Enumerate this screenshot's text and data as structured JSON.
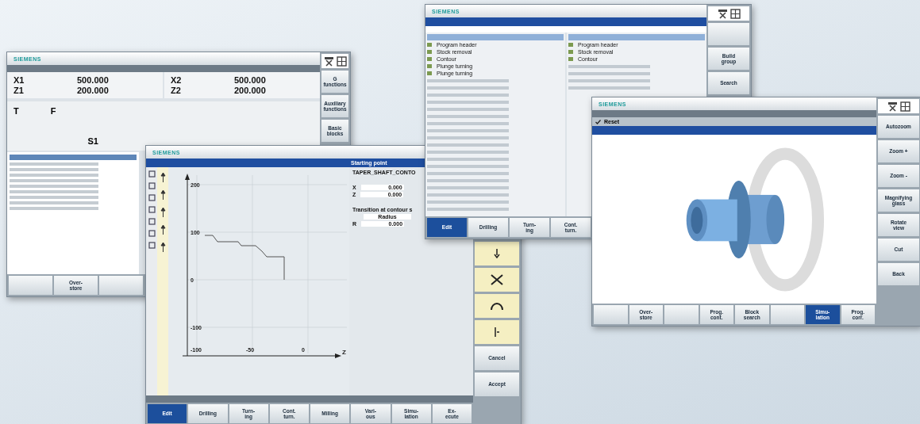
{
  "machine_screen": {
    "brand": "SIEMENS",
    "channels": [
      {
        "axes": [
          {
            "name": "X1",
            "value": "500.000"
          },
          {
            "name": "Z1",
            "value": "200.000"
          }
        ]
      },
      {
        "axes": [
          {
            "name": "X2",
            "value": "500.000"
          },
          {
            "name": "Z2",
            "value": "200.000"
          }
        ]
      }
    ],
    "tool": "T",
    "feed": "F",
    "spindle": "S1",
    "softkeys": [
      "G functions",
      "Auxiliary functions",
      "Basic blocks"
    ],
    "bottom_softkeys": [
      {
        "kind": "blank"
      },
      {
        "kind": "key",
        "label": "Over-\nstore",
        "selected": false
      },
      {
        "kind": "blank"
      }
    ]
  },
  "contour_screen": {
    "brand": "SIEMENS",
    "panel_title": "Starting point",
    "contour_name": "TAPER_SHAFT_CONTO",
    "fields": [
      {
        "label": "X",
        "value": "0.000"
      },
      {
        "label": "Z",
        "value": "0.000"
      }
    ],
    "transition_label": "Transition at contour s",
    "transition_type": "Radius",
    "transition_fields": [
      {
        "label": "R",
        "value": "0.000"
      }
    ],
    "graph": {
      "y_ticks": [
        "200",
        "100",
        "0",
        "-100"
      ],
      "x_ticks": [
        "-100",
        "-50",
        "0"
      ],
      "x_axis": "Z"
    },
    "softkeys": [
      "Cancel",
      "Accept"
    ],
    "bottom_softkeys": [
      {
        "kind": "key",
        "label": "Edit",
        "selected": true
      },
      {
        "kind": "key",
        "label": "Drilling",
        "selected": false
      },
      {
        "kind": "key",
        "label": "Turn-\ning",
        "selected": false
      },
      {
        "kind": "key",
        "label": "Cont.\nturn.",
        "selected": false
      },
      {
        "kind": "key",
        "label": "Milling",
        "selected": false
      },
      {
        "kind": "key",
        "label": "Vari-\nous",
        "selected": false
      },
      {
        "kind": "key",
        "label": "Simu-\nlation",
        "selected": false
      },
      {
        "kind": "key",
        "label": "Ex-\necute",
        "selected": false
      }
    ]
  },
  "program_screen": {
    "brand": "SIEMENS",
    "left_rows": [
      "Program header",
      "Stock removal",
      "Contour",
      "Plunge turning",
      "Plunge turning"
    ],
    "right_rows": [
      "Program header",
      "Stock removal",
      "Contour"
    ],
    "softkeys": [
      "Build\ngroup",
      "Search"
    ],
    "bottom_softkeys": [
      {
        "kind": "key",
        "label": "Edit",
        "selected": true
      },
      {
        "kind": "key",
        "label": "Drilling",
        "selected": false
      },
      {
        "kind": "key",
        "label": "Turn-\ning",
        "selected": false
      },
      {
        "kind": "key",
        "label": "Cont.\nturn.",
        "selected": false
      }
    ]
  },
  "simulation_screen": {
    "brand": "SIEMENS",
    "status": "Reset",
    "softkeys": [
      "Autozoom",
      "Zoom +",
      "Zoom -",
      "Magnifying\nglass",
      "Rotate\nview",
      "Cut",
      "Back"
    ],
    "bottom_softkeys": [
      {
        "kind": "blank"
      },
      {
        "kind": "key",
        "label": "Over-\nstore",
        "selected": false
      },
      {
        "kind": "blank"
      },
      {
        "kind": "key",
        "label": "Prog.\ncont.",
        "selected": false
      },
      {
        "kind": "key",
        "label": "Block\nsearch",
        "selected": false
      },
      {
        "kind": "blank"
      },
      {
        "kind": "key",
        "label": "Simu-\nlation",
        "selected": true
      },
      {
        "kind": "key",
        "label": "Prog.\ncorr.",
        "selected": false
      }
    ]
  }
}
